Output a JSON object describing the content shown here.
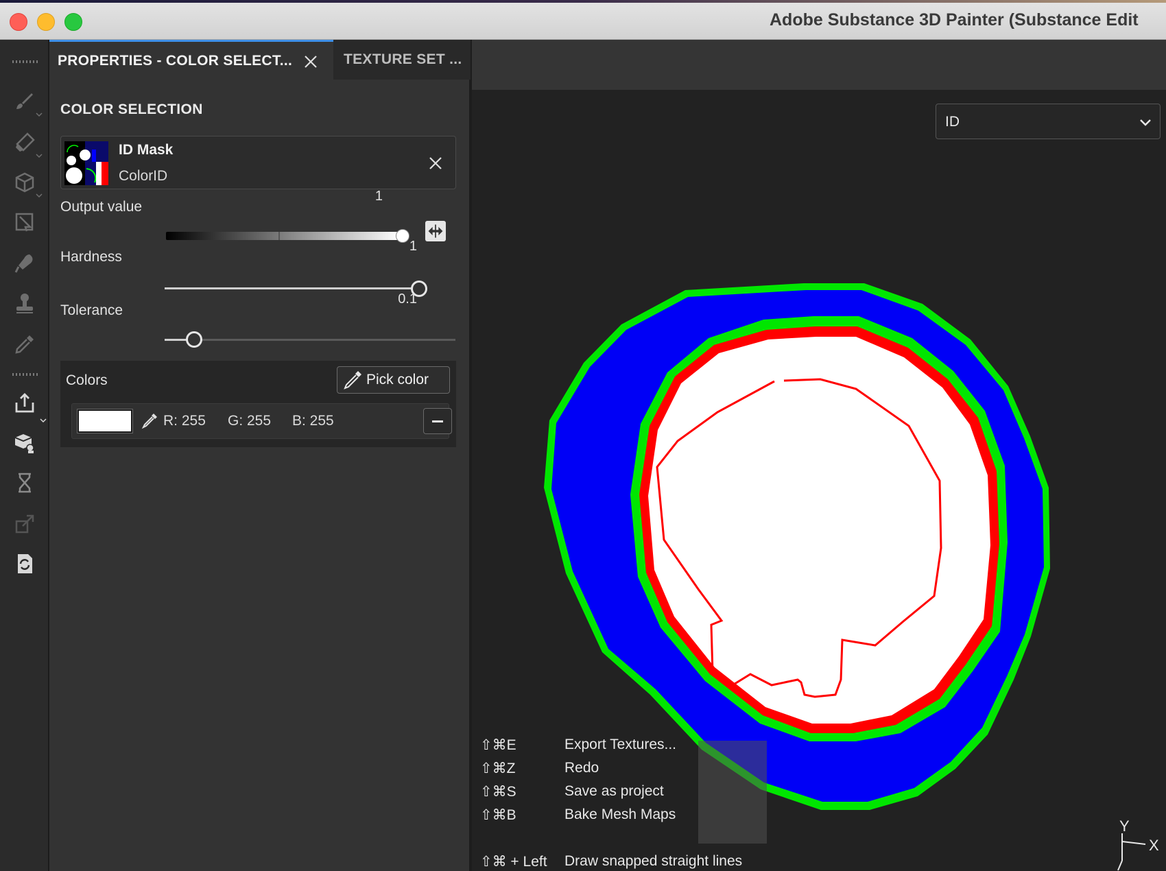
{
  "window": {
    "title": "Adobe Substance 3D Painter (Substance Edit"
  },
  "toolbar": {
    "tools": [
      {
        "icon": "paint-brush-icon"
      },
      {
        "icon": "eraser-icon"
      },
      {
        "icon": "projection-cube-icon"
      },
      {
        "icon": "polygon-fill-icon"
      },
      {
        "icon": "smudge-icon"
      },
      {
        "icon": "clone-stamp-icon"
      },
      {
        "icon": "color-picker-icon"
      },
      {
        "icon": "export-icon"
      },
      {
        "icon": "bake-icon"
      },
      {
        "icon": "history-icon"
      },
      {
        "icon": "resize-icon"
      },
      {
        "icon": "sync-icon"
      }
    ]
  },
  "panel": {
    "tabs": [
      {
        "label": "PROPERTIES - COLOR SELECT..."
      },
      {
        "label": "TEXTURE SET ..."
      }
    ],
    "section_title": "COLOR SELECTION",
    "mask": {
      "name": "ID Mask",
      "source": "ColorID"
    },
    "params": {
      "output_value": {
        "label": "Output value",
        "value": "1",
        "fraction": 1.0
      },
      "hardness": {
        "label": "Hardness",
        "value": "1",
        "fraction": 1.0
      },
      "tolerance": {
        "label": "Tolerance",
        "value": "0.1",
        "fraction": 0.1
      }
    },
    "colors": {
      "label": "Colors",
      "pick_button": "Pick color",
      "entries": [
        {
          "swatch": "#ffffff",
          "r": "R: 255",
          "g": "G: 255",
          "b": "B: 255"
        }
      ]
    }
  },
  "viewport": {
    "channel_dropdown": "ID",
    "shortcuts": [
      {
        "keys": "⇧⌘E",
        "action": "Export Textures..."
      },
      {
        "keys": "⇧⌘Z",
        "action": "Redo"
      },
      {
        "keys": "⇧⌘S",
        "action": "Save as project"
      },
      {
        "keys": "⇧⌘B",
        "action": "Bake Mesh Maps"
      },
      {
        "keys": "⇧⌘ + Left",
        "action": "Draw snapped straight lines"
      }
    ],
    "gizmo": {
      "y_label": "Y",
      "x_label": "X"
    },
    "colors": {
      "blue": "#0000ff",
      "green": "#00ff00",
      "red": "#ff0000",
      "white": "#ffffff"
    }
  }
}
